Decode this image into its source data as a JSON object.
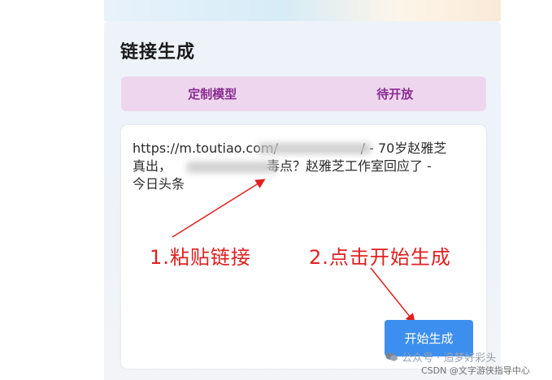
{
  "page": {
    "title": "链接生成"
  },
  "tabs": [
    {
      "label": "定制模型"
    },
    {
      "label": "待开放"
    }
  ],
  "input": {
    "text": "https://m.toutiao.com/                    / - 70岁赵雅芝\n真出，                       毒点？赵雅芝工作室回应了 -\n今日头条"
  },
  "annotations": {
    "step1": "1.粘贴链接",
    "step2": "2.点击开始生成"
  },
  "button": {
    "label": "开始生成"
  },
  "watermarks": {
    "line1": "公众号 · 追梦好彩头",
    "line2": "CSDN @文字游侠指导中心"
  },
  "colors": {
    "accent": "#3d8fef",
    "tab_bg": "#eed7ee",
    "tab_text": "#8a2c92",
    "annotation": "#e02020"
  },
  "icons": {
    "wechat": "wechat-icon"
  }
}
